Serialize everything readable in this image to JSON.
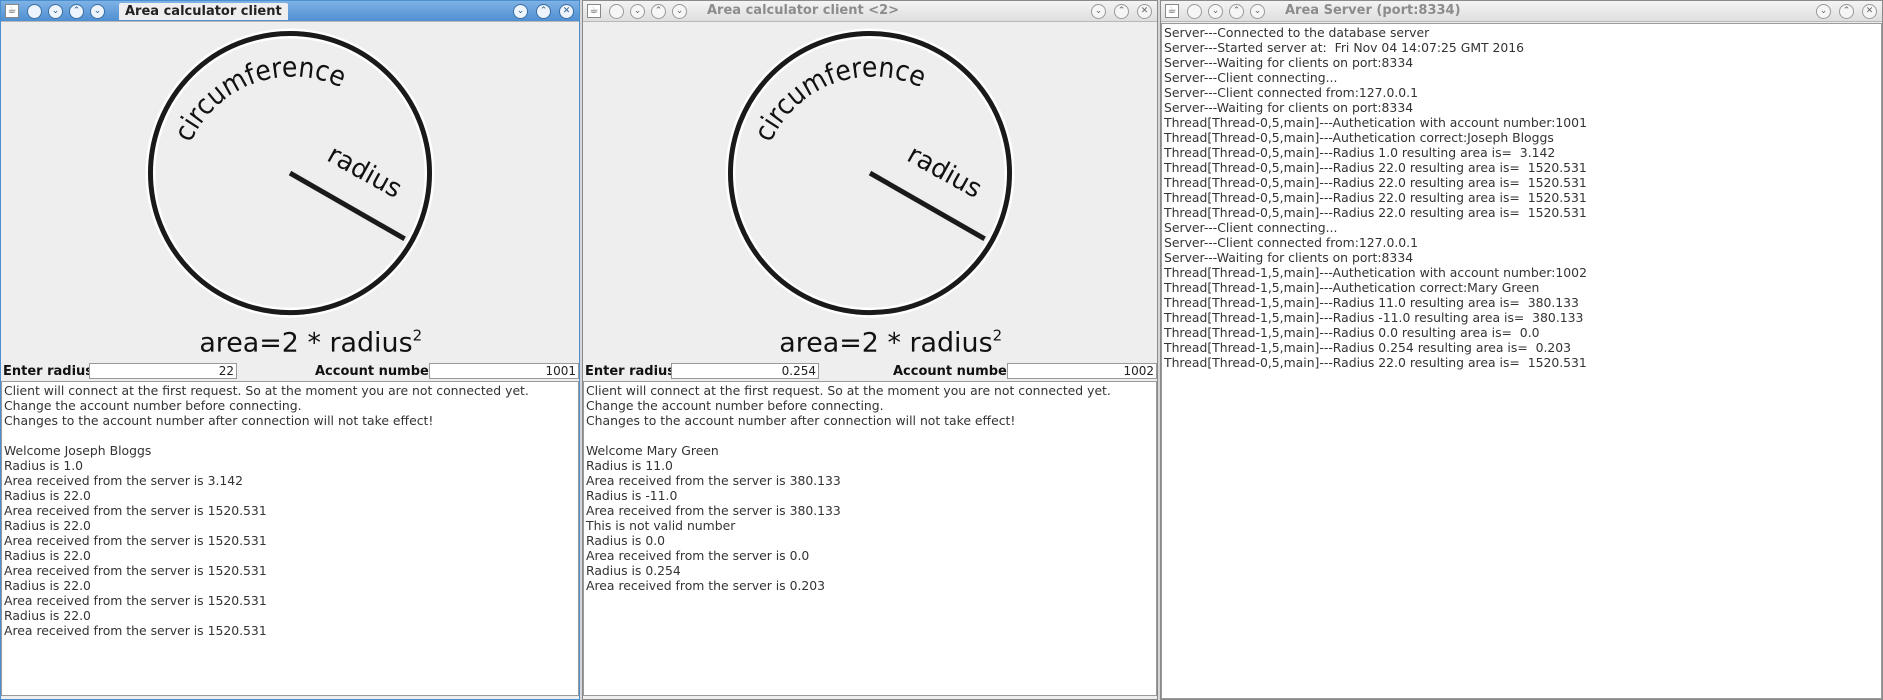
{
  "client1": {
    "title": "Area calculator client",
    "diagram": {
      "circumference": "circumference",
      "radius": "radius",
      "formula": "area=2 * radius",
      "superscript": "2"
    },
    "enter_radius_label": "Enter radius",
    "radius_value": "22",
    "account_label": "Account number",
    "account_value": "1001",
    "output_lines": [
      "Client will connect at the first request. So at the moment you are not connected yet.",
      "Change the account number before connecting.",
      "Changes to the account number after connection will not take effect!",
      "",
      "Welcome Joseph Bloggs",
      "Radius is 1.0",
      "Area received from the server is 3.142",
      "Radius is 22.0",
      "Area received from the server is 1520.531",
      "Radius is 22.0",
      "Area received from the server is 1520.531",
      "Radius is 22.0",
      "Area received from the server is 1520.531",
      "Radius is 22.0",
      "Area received from the server is 1520.531",
      "Radius is 22.0",
      "Area received from the server is 1520.531"
    ]
  },
  "client2": {
    "title": "Area calculator client <2>",
    "diagram": {
      "circumference": "circumference",
      "radius": "radius",
      "formula": "area=2 * radius",
      "superscript": "2"
    },
    "enter_radius_label": "Enter radius",
    "radius_value": "0.254",
    "account_label": "Account number",
    "account_value": "1002",
    "output_lines": [
      "Client will connect at the first request. So at the moment you are not connected yet.",
      "Change the account number before connecting.",
      "Changes to the account number after connection will not take effect!",
      "",
      "Welcome Mary Green",
      "Radius is 11.0",
      "Area received from the server is 380.133",
      "Radius is -11.0",
      "Area received from the server is 380.133",
      "This is not valid number",
      "Radius is 0.0",
      "Area received from the server is 0.0",
      "Radius is 0.254",
      "Area received from the server is 0.203"
    ]
  },
  "server": {
    "title": "Area Server (port:8334)",
    "log_lines": [
      "Server---Connected to the database server",
      "Server---Started server at:  Fri Nov 04 14:07:25 GMT 2016",
      "Server---Waiting for clients on port:8334",
      "Server---Client connecting...",
      "Server---Client connected from:127.0.0.1",
      "Server---Waiting for clients on port:8334",
      "Thread[Thread-0,5,main]---Authetication with account number:1001",
      "Thread[Thread-0,5,main]---Authetication correct:Joseph Bloggs",
      "Thread[Thread-0,5,main]---Radius 1.0 resulting area is=  3.142",
      "Thread[Thread-0,5,main]---Radius 22.0 resulting area is=  1520.531",
      "Thread[Thread-0,5,main]---Radius 22.0 resulting area is=  1520.531",
      "Thread[Thread-0,5,main]---Radius 22.0 resulting area is=  1520.531",
      "Thread[Thread-0,5,main]---Radius 22.0 resulting area is=  1520.531",
      "Server---Client connecting...",
      "Server---Client connected from:127.0.0.1",
      "Server---Waiting for clients on port:8334",
      "Thread[Thread-1,5,main]---Authetication with account number:1002",
      "Thread[Thread-1,5,main]---Authetication correct:Mary Green",
      "Thread[Thread-1,5,main]---Radius 11.0 resulting area is=  380.133",
      "Thread[Thread-1,5,main]---Radius -11.0 resulting area is=  380.133",
      "Thread[Thread-1,5,main]---Radius 0.0 resulting area is=  0.0",
      "Thread[Thread-1,5,main]---Radius 0.254 resulting area is=  0.203",
      "Thread[Thread-0,5,main]---Radius 22.0 resulting area is=  1520.531"
    ]
  },
  "icons": {
    "window_menu": "java-cup-icon",
    "minimize": "chevron-down-icon",
    "maximize": "chevron-up-icon",
    "close": "close-icon"
  }
}
